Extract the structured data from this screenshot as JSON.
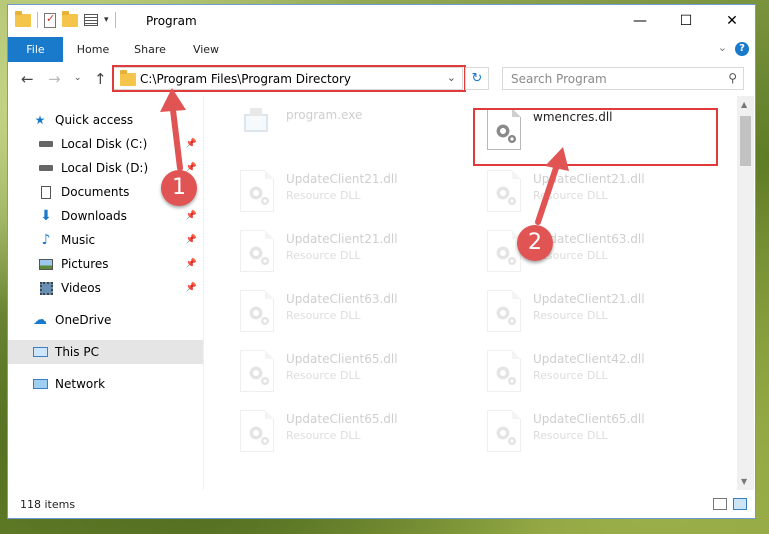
{
  "window": {
    "title": "Program",
    "controls": [
      "minimize",
      "maximize",
      "close"
    ]
  },
  "ribbon": {
    "tabs": [
      "File",
      "Home",
      "Share",
      "View"
    ],
    "help": "?"
  },
  "address": {
    "path": "C:\\Program Files\\Program Directory",
    "search_placeholder": "Search Program"
  },
  "sidebar": {
    "items": [
      {
        "label": "Quick access",
        "icon": "star-icon"
      },
      {
        "label": "Local Disk (C:)",
        "icon": "drive-icon",
        "pinned": true
      },
      {
        "label": "Local Disk (D:)",
        "icon": "drive-icon",
        "pinned": true
      },
      {
        "label": "Documents",
        "icon": "document-icon",
        "pinned": true
      },
      {
        "label": "Downloads",
        "icon": "download-icon",
        "pinned": true
      },
      {
        "label": "Music",
        "icon": "music-icon",
        "pinned": true
      },
      {
        "label": "Pictures",
        "icon": "picture-icon",
        "pinned": true
      },
      {
        "label": "Videos",
        "icon": "video-icon",
        "pinned": true
      },
      {
        "label": "OneDrive",
        "icon": "cloud-icon"
      },
      {
        "label": "This PC",
        "icon": "computer-icon",
        "selected": true
      },
      {
        "label": "Network",
        "icon": "network-icon"
      }
    ]
  },
  "files": {
    "left": [
      {
        "name": "program.exe",
        "type": ""
      },
      {
        "name": "UpdateClient21.dll",
        "type": "Resource DLL"
      },
      {
        "name": "UpdateClient21.dll",
        "type": "Resource DLL"
      },
      {
        "name": "UpdateClient63.dll",
        "type": "Resource DLL"
      },
      {
        "name": "UpdateClient65.dll",
        "type": "Resource DLL"
      },
      {
        "name": "UpdateClient65.dll",
        "type": "Resource DLL"
      }
    ],
    "right": [
      {
        "name": "wmencres.dll",
        "type": ""
      },
      {
        "name": "UpdateClient21.dll",
        "type": "Resource DLL"
      },
      {
        "name": "UpdateClient63.dll",
        "type": "Resource DLL"
      },
      {
        "name": "UpdateClient21.dll",
        "type": "Resource DLL"
      },
      {
        "name": "UpdateClient42.dll",
        "type": "Resource DLL"
      },
      {
        "name": "UpdateClient65.dll",
        "type": "Resource DLL"
      }
    ]
  },
  "status": {
    "item_count": "118 items"
  },
  "annotations": {
    "step1": "1",
    "step2": "2",
    "color": "#e03a3a"
  }
}
